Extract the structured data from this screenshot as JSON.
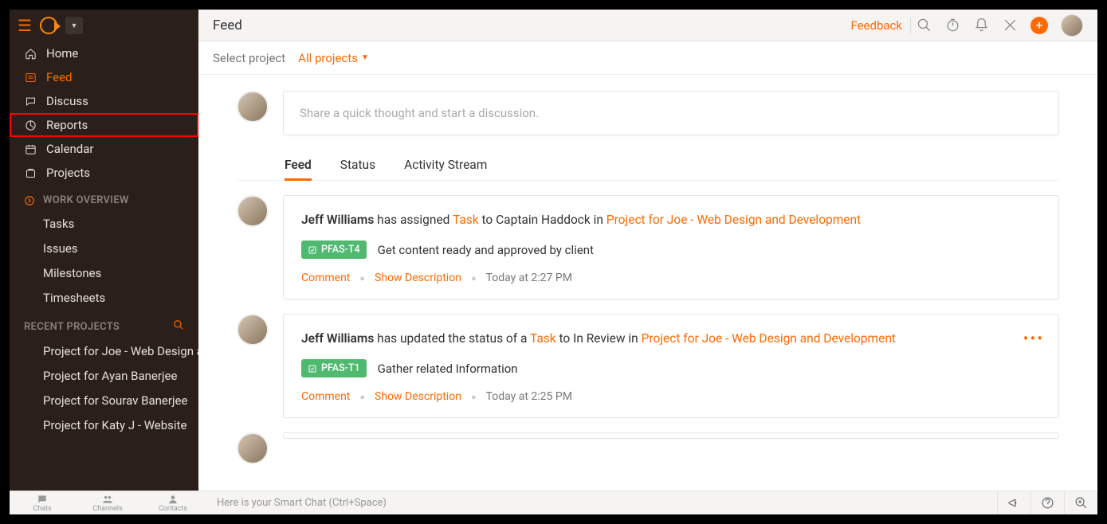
{
  "header": {
    "title": "Feed",
    "feedback": "Feedback"
  },
  "project_bar": {
    "label": "Select project",
    "selected": "All projects"
  },
  "sidebar": {
    "nav": {
      "home": "Home",
      "feed": "Feed",
      "discuss": "Discuss",
      "reports": "Reports",
      "calendar": "Calendar",
      "projects": "Projects"
    },
    "work_overview": {
      "title": "WORK OVERVIEW",
      "tasks": "Tasks",
      "issues": "Issues",
      "milestones": "Milestones",
      "timesheets": "Timesheets"
    },
    "recent_projects": {
      "title": "RECENT PROJECTS",
      "items": [
        "Project for Joe - Web Design and Development",
        "Project for Ayan Banerjee",
        "Project for Sourav Banerjee",
        "Project for Katy J - Website"
      ]
    }
  },
  "share": {
    "placeholder": "Share a quick thought and start a discussion."
  },
  "tabs": {
    "feed": "Feed",
    "status": "Status",
    "activity": "Activity Stream"
  },
  "feed": [
    {
      "author": "Jeff Williams",
      "verb": " has assigned ",
      "obj": "Task",
      "mid": " to Captain Haddock in ",
      "project": "Project for Joe - Web Design and Development",
      "chip": "PFAS-T4",
      "task_title": "Get content ready and approved by client",
      "comment": "Comment",
      "show_desc": "Show Description",
      "time": "Today at 2:27 PM",
      "show_more": false
    },
    {
      "author": "Jeff Williams",
      "verb": " has updated the status of a ",
      "obj": "Task",
      "mid": " to In Review in ",
      "project": "Project for Joe - Web Design and Development",
      "chip": "PFAS-T1",
      "task_title": "Gather related Information",
      "comment": "Comment",
      "show_desc": "Show Description",
      "time": "Today at 2:25 PM",
      "show_more": true
    }
  ],
  "bottom": {
    "chats": "Chats",
    "channels": "Channels",
    "contacts": "Contacts",
    "smartchat": "Here is your Smart Chat (Ctrl+Space)"
  }
}
